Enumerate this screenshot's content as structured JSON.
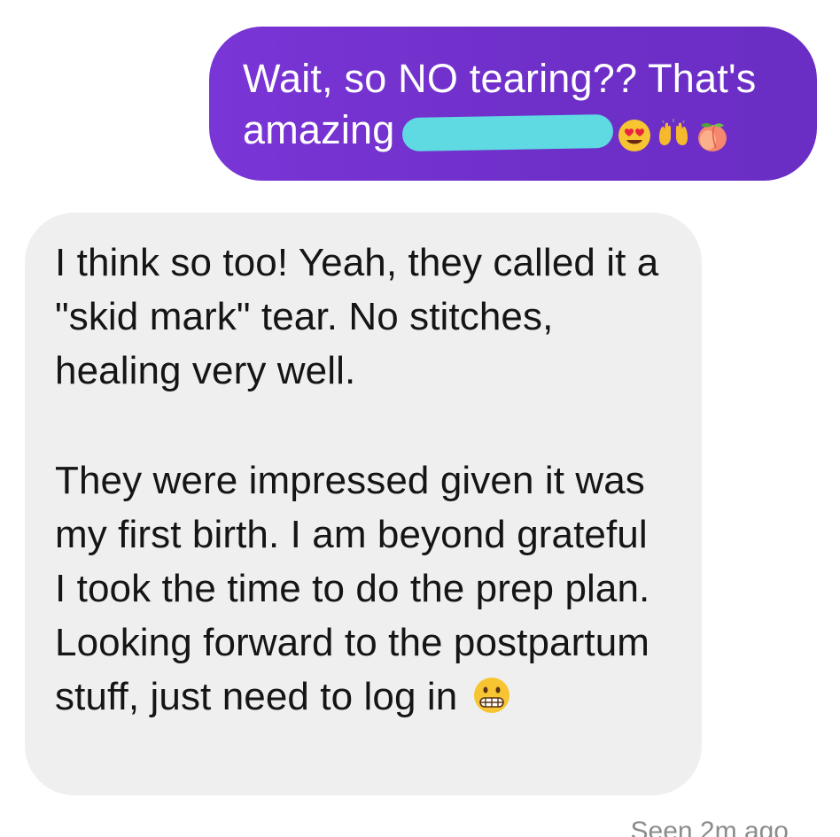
{
  "conversation": {
    "sent_message": {
      "line1": "Wait, so NO tearing?? That's",
      "line2_text": "amazing",
      "redacted": true,
      "emojis": [
        "heart-eyes-face-icon",
        "raising-hands-icon",
        "peach-icon"
      ]
    },
    "received_message": {
      "paragraph1": "I think so too! Yeah, they called it a \"skid mark\" tear. No stitches, healing very well.",
      "paragraph2": "They were impressed given it was my first birth. I am beyond grateful I took the time to do the prep plan. Looking forward to the postpartum stuff, just need to log in",
      "emoji": "grimacing-face-icon"
    },
    "status": "Seen 2m ago"
  },
  "colors": {
    "sent_bubble": "#7030cc",
    "received_bubble": "#efefef",
    "redaction": "#5fd9e2",
    "status_text": "#8c8c8c"
  }
}
